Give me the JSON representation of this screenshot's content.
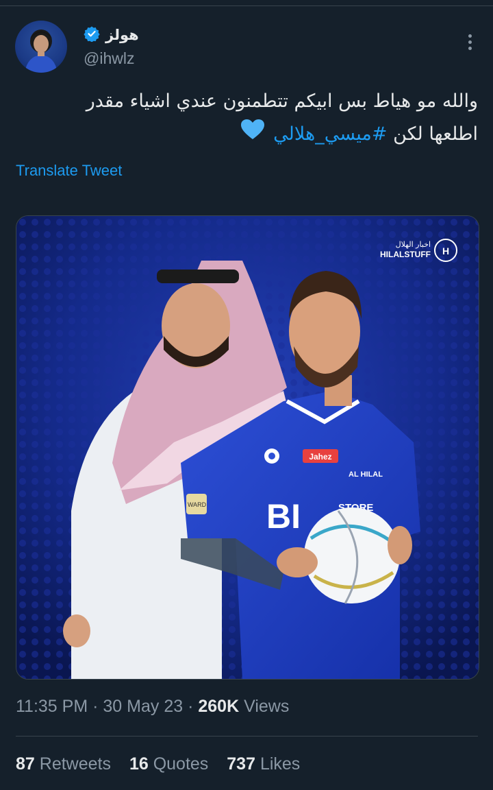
{
  "author": {
    "display_name": "هولز",
    "handle": "@ihwlz",
    "verified": true
  },
  "tweet": {
    "line1": "والله مو هياط بس ابيكم تتطمنون عندي اشياء مقدر",
    "line2_text": "اطلعها لكن ",
    "hashtag": "#ميسي_هلالي",
    "emoji": "blue-heart-icon",
    "translate_label": "Translate Tweet"
  },
  "media": {
    "watermark_ar": "اخبار الهلال",
    "watermark_en": "HILALSTUFF",
    "jersey_sponsor": "Jahez",
    "jersey_text": "BI",
    "jersey_store": "STORE",
    "club_badge_text": "AL HILAL",
    "patch_text": "WARD"
  },
  "meta": {
    "time": "11:35 PM",
    "date": "30 May 23",
    "views_count": "260K",
    "views_label": "Views",
    "dot": "·"
  },
  "stats": {
    "retweets_count": "87",
    "retweets_label": "Retweets",
    "quotes_count": "16",
    "quotes_label": "Quotes",
    "likes_count": "737",
    "likes_label": "Likes"
  },
  "colors": {
    "background": "#15202b",
    "accent": "#1d9bf0",
    "text_primary": "#e7e9ea",
    "text_secondary": "#8b98a5",
    "divider": "#38444d"
  }
}
